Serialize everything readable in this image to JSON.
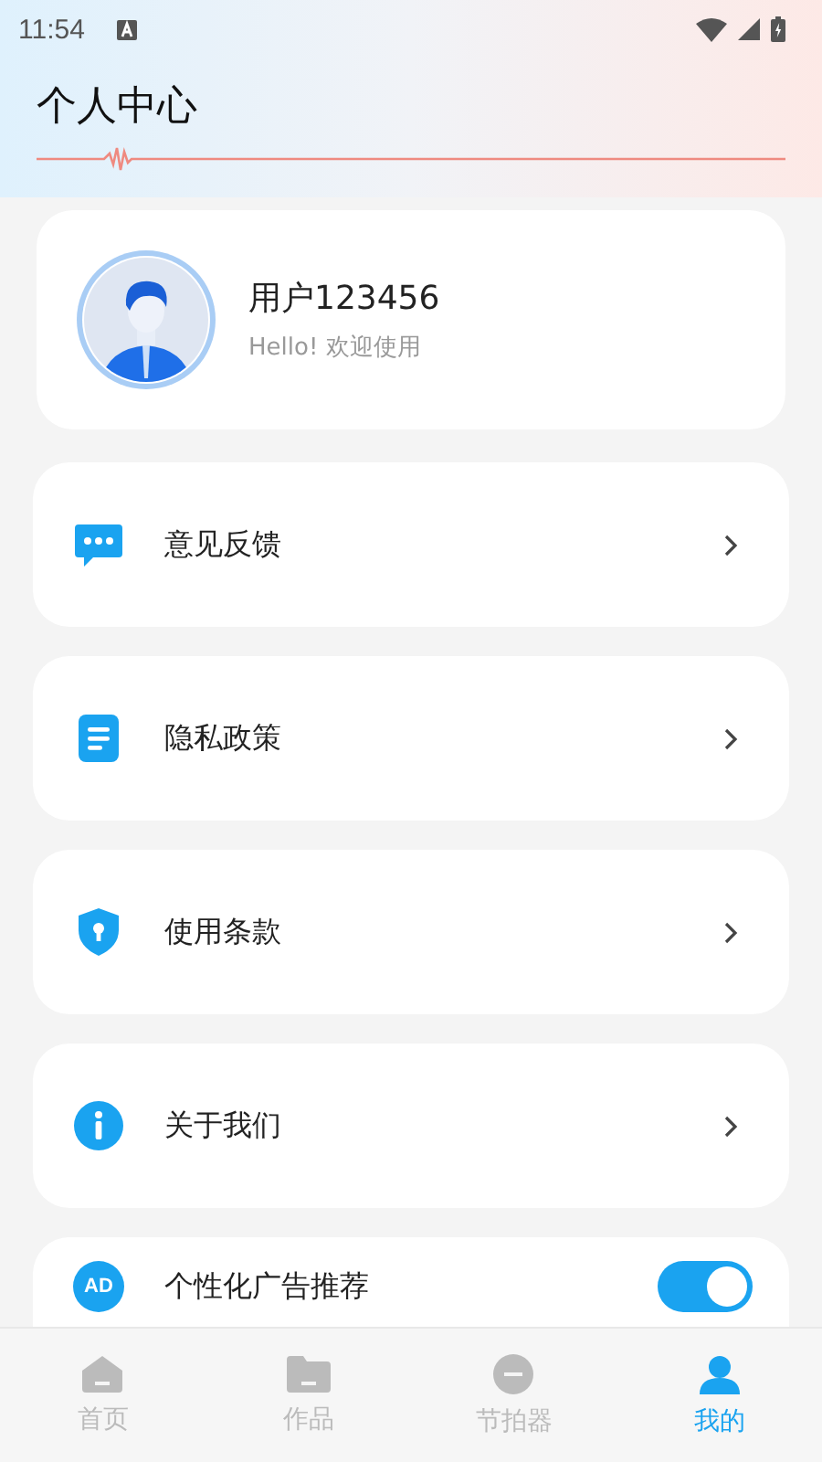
{
  "status_bar": {
    "time": "11:54"
  },
  "header": {
    "title": "个人中心"
  },
  "profile": {
    "name": "用户123456",
    "greeting": "Hello! 欢迎使用"
  },
  "menu": [
    {
      "kind": "link",
      "label": "意见反馈"
    },
    {
      "kind": "link",
      "label": "隐私政策"
    },
    {
      "kind": "link",
      "label": "使用条款"
    },
    {
      "kind": "link",
      "label": "关于我们"
    },
    {
      "kind": "toggle",
      "label": "个性化广告推荐",
      "badge": "AD",
      "on": true
    }
  ],
  "tabs": [
    {
      "label": "首页",
      "selected": false
    },
    {
      "label": "作品",
      "selected": false
    },
    {
      "label": "节拍器",
      "selected": false
    },
    {
      "label": "我的",
      "selected": true
    }
  ]
}
